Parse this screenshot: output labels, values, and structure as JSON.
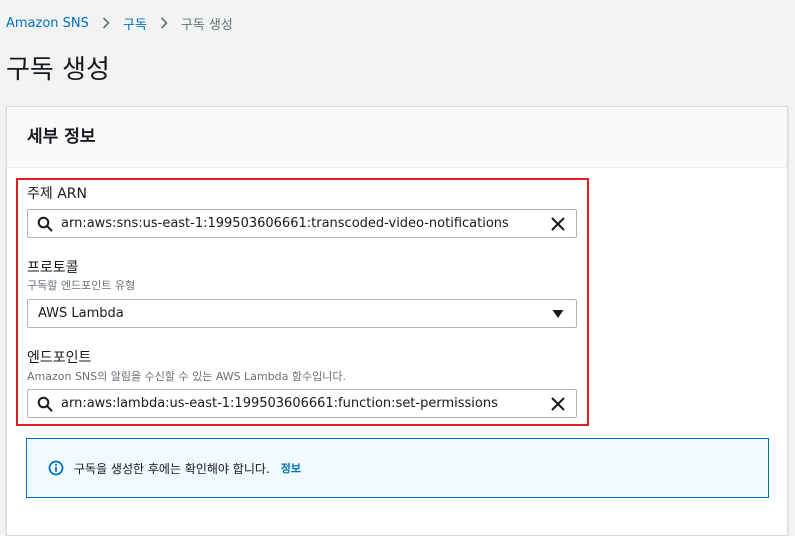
{
  "breadcrumb": {
    "items": [
      {
        "label": "Amazon SNS"
      },
      {
        "label": "구독"
      },
      {
        "label": "구독 생성"
      }
    ]
  },
  "page": {
    "title": "구독 생성"
  },
  "details_panel": {
    "title": "세부 정보",
    "topic_arn": {
      "label": "주제 ARN",
      "value": "arn:aws:sns:us-east-1:199503606661:transcoded-video-notifications"
    },
    "protocol": {
      "label": "프로토콜",
      "description": "구독할 엔드포인트 유형",
      "selected": "AWS Lambda"
    },
    "endpoint": {
      "label": "엔드포인트",
      "description": "Amazon SNS의 알림을 수신할 수 있는 AWS Lambda 함수입니다.",
      "value": "arn:aws:lambda:us-east-1:199503606661:function:set-permissions"
    },
    "info_alert": {
      "text": "구독을 생성한 후에는 확인해야 합니다.",
      "link": "정보"
    }
  },
  "icons": {
    "search": "search-icon",
    "clear": "close-icon",
    "dropdown": "caret-down-icon",
    "info": "info-icon",
    "separator": "chevron-right-icon"
  },
  "colors": {
    "link": "#0073bb",
    "highlight_border": "#e02020",
    "alert_background": "#f1faff"
  }
}
